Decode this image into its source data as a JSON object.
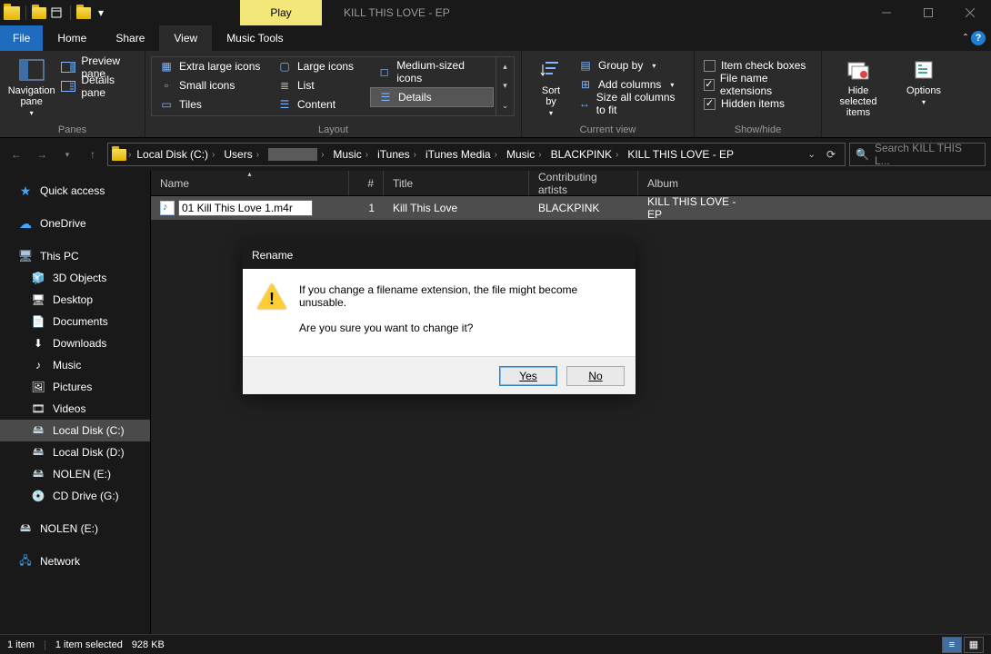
{
  "title": "KILL THIS LOVE - EP",
  "play_tab": "Play",
  "tabs": {
    "file": "File",
    "home": "Home",
    "share": "Share",
    "view": "View",
    "music": "Music Tools"
  },
  "ribbon": {
    "panes": {
      "nav": "Navigation\npane",
      "preview": "Preview pane",
      "details_pane": "Details pane",
      "label": "Panes"
    },
    "layout": {
      "xl": "Extra large icons",
      "large": "Large icons",
      "medium": "Medium-sized icons",
      "small": "Small icons",
      "list": "List",
      "details": "Details",
      "tiles": "Tiles",
      "content": "Content",
      "label": "Layout"
    },
    "current": {
      "sort": "Sort\nby",
      "group": "Group by",
      "addcols": "Add columns",
      "sizecols": "Size all columns to fit",
      "label": "Current view"
    },
    "showhide": {
      "itemcb": "Item check boxes",
      "ext": "File name extensions",
      "hidden": "Hidden items",
      "hidesel": "Hide selected\nitems",
      "options": "Options",
      "label": "Show/hide"
    }
  },
  "breadcrumbs": [
    "Local Disk (C:)",
    "Users",
    "",
    "Music",
    "iTunes",
    "iTunes Media",
    "Music",
    "BLACKPINK",
    "KILL THIS LOVE - EP"
  ],
  "search_placeholder": "Search KILL THIS L...",
  "sidebar": {
    "quick": "Quick access",
    "onedrive": "OneDrive",
    "thispc": "This PC",
    "items": [
      "3D Objects",
      "Desktop",
      "Documents",
      "Downloads",
      "Music",
      "Pictures",
      "Videos",
      "Local Disk (C:)",
      "Local Disk (D:)",
      "NOLEN (E:)",
      "CD Drive (G:)"
    ],
    "nolen": "NOLEN (E:)",
    "network": "Network"
  },
  "columns": {
    "name": "Name",
    "num": "#",
    "title": "Title",
    "artists": "Contributing artists",
    "album": "Album"
  },
  "file": {
    "rename": "01 Kill This Love 1.m4r",
    "num": "1",
    "title": "Kill This Love",
    "artist": "BLACKPINK",
    "album": "KILL THIS LOVE - EP"
  },
  "dialog": {
    "title": "Rename",
    "line1": "If you change a filename extension, the file might become unusable.",
    "line2": "Are you sure you want to change it?",
    "yes": "Yes",
    "no": "No"
  },
  "status": {
    "count": "1 item",
    "sel": "1 item selected",
    "size": "928 KB"
  }
}
